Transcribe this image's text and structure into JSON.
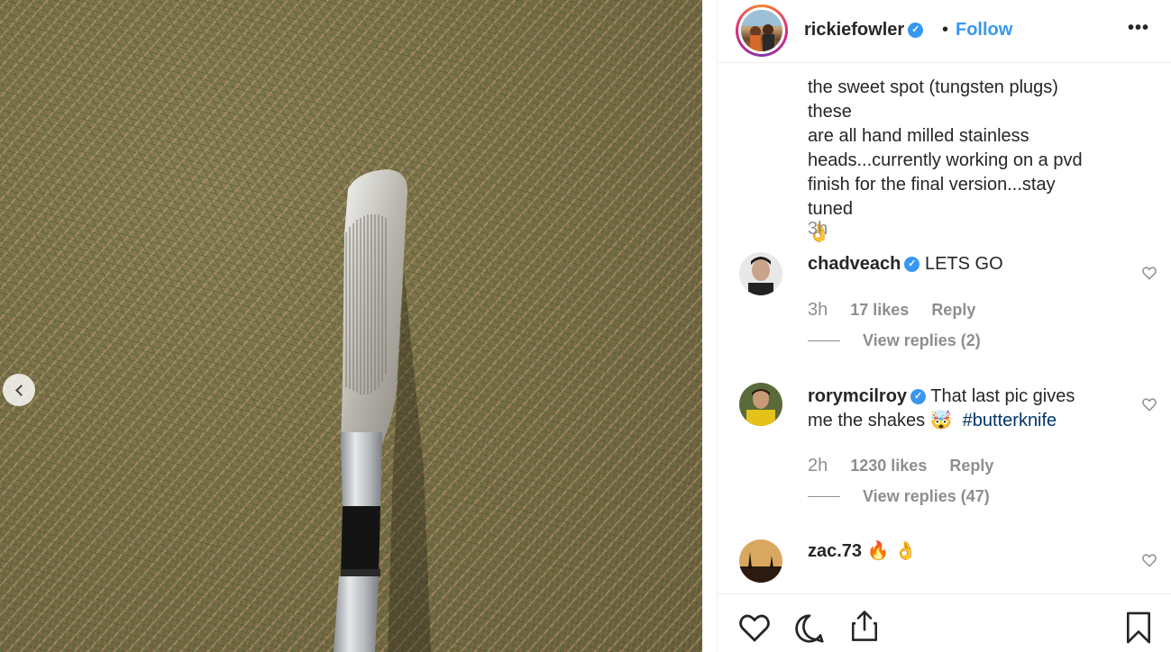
{
  "post": {
    "nav_prev_icon": "chevron-left-icon"
  },
  "header": {
    "username": "rickiefowler",
    "verified_icon": "verified-badge-icon",
    "separator": "•",
    "follow_label": "Follow",
    "more_label": "•••"
  },
  "caption": {
    "text_lines": [
      "the sweet spot (tungsten plugs) these",
      "are all hand milled stainless",
      "heads...currently working on a pvd",
      "finish for the final version...stay tuned"
    ],
    "emoji": "👌",
    "time": "3h"
  },
  "comments": [
    {
      "username": "chadveach",
      "verified": true,
      "text": "LETS GO",
      "time": "3h",
      "likes": "17 likes",
      "reply_label": "Reply",
      "view_replies": "View replies (2)"
    },
    {
      "username": "rorymcilroy",
      "verified": true,
      "text_part1": "That last pic gives",
      "text_part2": "me the shakes",
      "emoji": "🤯",
      "hashtag": "#butterknife",
      "time": "2h",
      "likes": "1230 likes",
      "reply_label": "Reply",
      "view_replies": "View replies (47)"
    },
    {
      "username": "zac.73",
      "verified": false,
      "text": "🔥 👌"
    }
  ],
  "actions": {
    "like_icon": "heart-icon",
    "comment_icon": "comment-icon",
    "share_icon": "share-icon",
    "save_icon": "bookmark-icon"
  },
  "colors": {
    "accent": "#3897f0",
    "muted": "#8e8e8e",
    "text": "#262626",
    "hashtag": "#003569"
  }
}
